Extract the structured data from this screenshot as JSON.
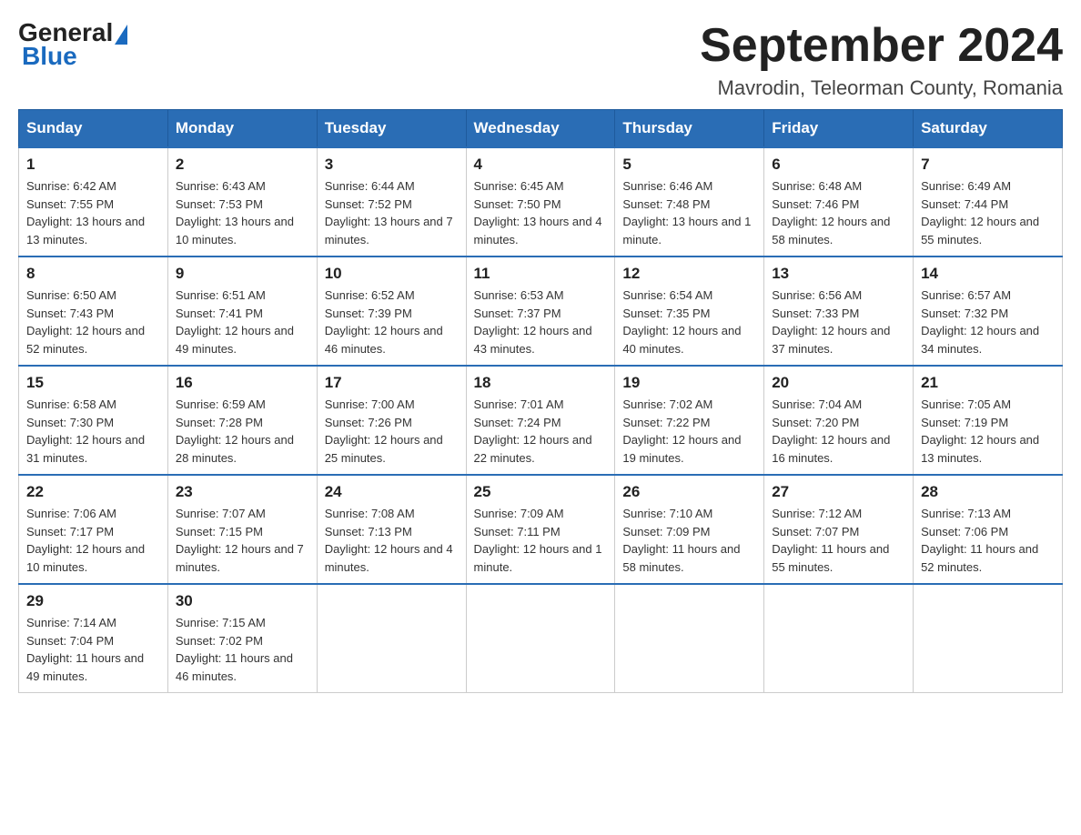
{
  "logo": {
    "general": "General",
    "blue": "Blue"
  },
  "title": "September 2024",
  "location": "Mavrodin, Teleorman County, Romania",
  "days_of_week": [
    "Sunday",
    "Monday",
    "Tuesday",
    "Wednesday",
    "Thursday",
    "Friday",
    "Saturday"
  ],
  "weeks": [
    [
      {
        "day": "1",
        "sunrise": "Sunrise: 6:42 AM",
        "sunset": "Sunset: 7:55 PM",
        "daylight": "Daylight: 13 hours and 13 minutes."
      },
      {
        "day": "2",
        "sunrise": "Sunrise: 6:43 AM",
        "sunset": "Sunset: 7:53 PM",
        "daylight": "Daylight: 13 hours and 10 minutes."
      },
      {
        "day": "3",
        "sunrise": "Sunrise: 6:44 AM",
        "sunset": "Sunset: 7:52 PM",
        "daylight": "Daylight: 13 hours and 7 minutes."
      },
      {
        "day": "4",
        "sunrise": "Sunrise: 6:45 AM",
        "sunset": "Sunset: 7:50 PM",
        "daylight": "Daylight: 13 hours and 4 minutes."
      },
      {
        "day": "5",
        "sunrise": "Sunrise: 6:46 AM",
        "sunset": "Sunset: 7:48 PM",
        "daylight": "Daylight: 13 hours and 1 minute."
      },
      {
        "day": "6",
        "sunrise": "Sunrise: 6:48 AM",
        "sunset": "Sunset: 7:46 PM",
        "daylight": "Daylight: 12 hours and 58 minutes."
      },
      {
        "day": "7",
        "sunrise": "Sunrise: 6:49 AM",
        "sunset": "Sunset: 7:44 PM",
        "daylight": "Daylight: 12 hours and 55 minutes."
      }
    ],
    [
      {
        "day": "8",
        "sunrise": "Sunrise: 6:50 AM",
        "sunset": "Sunset: 7:43 PM",
        "daylight": "Daylight: 12 hours and 52 minutes."
      },
      {
        "day": "9",
        "sunrise": "Sunrise: 6:51 AM",
        "sunset": "Sunset: 7:41 PM",
        "daylight": "Daylight: 12 hours and 49 minutes."
      },
      {
        "day": "10",
        "sunrise": "Sunrise: 6:52 AM",
        "sunset": "Sunset: 7:39 PM",
        "daylight": "Daylight: 12 hours and 46 minutes."
      },
      {
        "day": "11",
        "sunrise": "Sunrise: 6:53 AM",
        "sunset": "Sunset: 7:37 PM",
        "daylight": "Daylight: 12 hours and 43 minutes."
      },
      {
        "day": "12",
        "sunrise": "Sunrise: 6:54 AM",
        "sunset": "Sunset: 7:35 PM",
        "daylight": "Daylight: 12 hours and 40 minutes."
      },
      {
        "day": "13",
        "sunrise": "Sunrise: 6:56 AM",
        "sunset": "Sunset: 7:33 PM",
        "daylight": "Daylight: 12 hours and 37 minutes."
      },
      {
        "day": "14",
        "sunrise": "Sunrise: 6:57 AM",
        "sunset": "Sunset: 7:32 PM",
        "daylight": "Daylight: 12 hours and 34 minutes."
      }
    ],
    [
      {
        "day": "15",
        "sunrise": "Sunrise: 6:58 AM",
        "sunset": "Sunset: 7:30 PM",
        "daylight": "Daylight: 12 hours and 31 minutes."
      },
      {
        "day": "16",
        "sunrise": "Sunrise: 6:59 AM",
        "sunset": "Sunset: 7:28 PM",
        "daylight": "Daylight: 12 hours and 28 minutes."
      },
      {
        "day": "17",
        "sunrise": "Sunrise: 7:00 AM",
        "sunset": "Sunset: 7:26 PM",
        "daylight": "Daylight: 12 hours and 25 minutes."
      },
      {
        "day": "18",
        "sunrise": "Sunrise: 7:01 AM",
        "sunset": "Sunset: 7:24 PM",
        "daylight": "Daylight: 12 hours and 22 minutes."
      },
      {
        "day": "19",
        "sunrise": "Sunrise: 7:02 AM",
        "sunset": "Sunset: 7:22 PM",
        "daylight": "Daylight: 12 hours and 19 minutes."
      },
      {
        "day": "20",
        "sunrise": "Sunrise: 7:04 AM",
        "sunset": "Sunset: 7:20 PM",
        "daylight": "Daylight: 12 hours and 16 minutes."
      },
      {
        "day": "21",
        "sunrise": "Sunrise: 7:05 AM",
        "sunset": "Sunset: 7:19 PM",
        "daylight": "Daylight: 12 hours and 13 minutes."
      }
    ],
    [
      {
        "day": "22",
        "sunrise": "Sunrise: 7:06 AM",
        "sunset": "Sunset: 7:17 PM",
        "daylight": "Daylight: 12 hours and 10 minutes."
      },
      {
        "day": "23",
        "sunrise": "Sunrise: 7:07 AM",
        "sunset": "Sunset: 7:15 PM",
        "daylight": "Daylight: 12 hours and 7 minutes."
      },
      {
        "day": "24",
        "sunrise": "Sunrise: 7:08 AM",
        "sunset": "Sunset: 7:13 PM",
        "daylight": "Daylight: 12 hours and 4 minutes."
      },
      {
        "day": "25",
        "sunrise": "Sunrise: 7:09 AM",
        "sunset": "Sunset: 7:11 PM",
        "daylight": "Daylight: 12 hours and 1 minute."
      },
      {
        "day": "26",
        "sunrise": "Sunrise: 7:10 AM",
        "sunset": "Sunset: 7:09 PM",
        "daylight": "Daylight: 11 hours and 58 minutes."
      },
      {
        "day": "27",
        "sunrise": "Sunrise: 7:12 AM",
        "sunset": "Sunset: 7:07 PM",
        "daylight": "Daylight: 11 hours and 55 minutes."
      },
      {
        "day": "28",
        "sunrise": "Sunrise: 7:13 AM",
        "sunset": "Sunset: 7:06 PM",
        "daylight": "Daylight: 11 hours and 52 minutes."
      }
    ],
    [
      {
        "day": "29",
        "sunrise": "Sunrise: 7:14 AM",
        "sunset": "Sunset: 7:04 PM",
        "daylight": "Daylight: 11 hours and 49 minutes."
      },
      {
        "day": "30",
        "sunrise": "Sunrise: 7:15 AM",
        "sunset": "Sunset: 7:02 PM",
        "daylight": "Daylight: 11 hours and 46 minutes."
      },
      null,
      null,
      null,
      null,
      null
    ]
  ]
}
